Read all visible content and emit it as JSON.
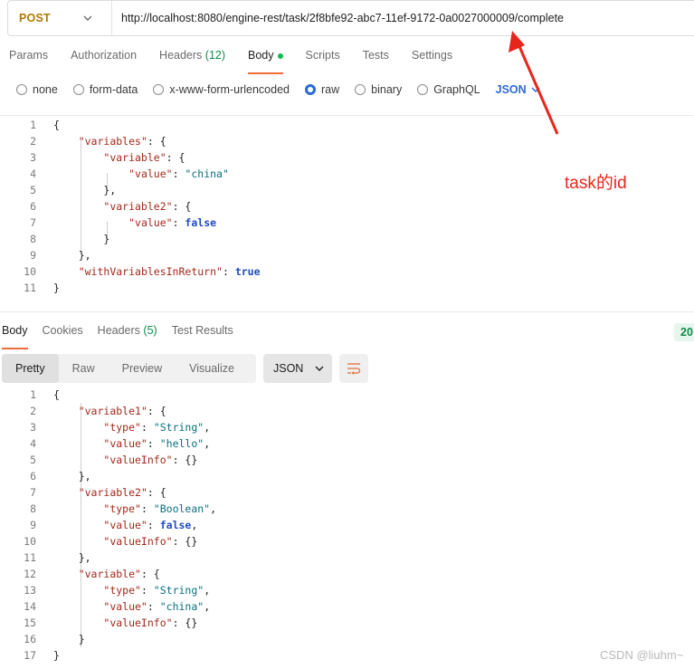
{
  "request": {
    "method": "POST",
    "url": "http://localhost:8080/engine-rest/task/2f8bfe92-abc7-11ef-9172-0a0027000009/complete"
  },
  "request_tabs": [
    {
      "label": "Params"
    },
    {
      "label": "Authorization"
    },
    {
      "label": "Headers",
      "count": "(12)"
    },
    {
      "label": "Body",
      "active": true
    },
    {
      "label": "Scripts"
    },
    {
      "label": "Tests"
    },
    {
      "label": "Settings"
    }
  ],
  "body_types": [
    {
      "label": "none",
      "checked": false
    },
    {
      "label": "form-data",
      "checked": false
    },
    {
      "label": "x-www-form-urlencoded",
      "checked": false
    },
    {
      "label": "raw",
      "checked": true
    },
    {
      "label": "binary",
      "checked": false
    },
    {
      "label": "GraphQL",
      "checked": false
    }
  ],
  "raw_language": "JSON",
  "request_body_lines": [
    {
      "n": "1",
      "tokens": [
        [
          "p",
          "{"
        ]
      ]
    },
    {
      "n": "2",
      "tokens": [
        [
          "p",
          "    "
        ],
        [
          "k",
          "\"variables\""
        ],
        [
          "p",
          ": {"
        ]
      ]
    },
    {
      "n": "3",
      "tokens": [
        [
          "p",
          "        "
        ],
        [
          "k",
          "\"variable\""
        ],
        [
          "p",
          ": {"
        ]
      ]
    },
    {
      "n": "4",
      "tokens": [
        [
          "p",
          "            "
        ],
        [
          "k",
          "\"value\""
        ],
        [
          "p",
          ": "
        ],
        [
          "s",
          "\"china\""
        ]
      ]
    },
    {
      "n": "5",
      "tokens": [
        [
          "p",
          "        },"
        ]
      ]
    },
    {
      "n": "6",
      "tokens": [
        [
          "p",
          "        "
        ],
        [
          "k",
          "\"variable2\""
        ],
        [
          "p",
          ": {"
        ]
      ]
    },
    {
      "n": "7",
      "tokens": [
        [
          "p",
          "            "
        ],
        [
          "k",
          "\"value\""
        ],
        [
          "p",
          ": "
        ],
        [
          "b",
          "false"
        ]
      ]
    },
    {
      "n": "8",
      "tokens": [
        [
          "p",
          "        }"
        ]
      ]
    },
    {
      "n": "9",
      "tokens": [
        [
          "p",
          "    },"
        ]
      ]
    },
    {
      "n": "10",
      "tokens": [
        [
          "p",
          "    "
        ],
        [
          "k",
          "\"withVariablesInReturn\""
        ],
        [
          "p",
          ": "
        ],
        [
          "b",
          "true"
        ]
      ]
    },
    {
      "n": "11",
      "tokens": [
        [
          "p",
          "}"
        ]
      ]
    }
  ],
  "response_tabs": [
    {
      "label": "Body",
      "active": true
    },
    {
      "label": "Cookies"
    },
    {
      "label": "Headers",
      "count": "(5)"
    },
    {
      "label": "Test Results"
    }
  ],
  "response_status": "20",
  "view_modes": [
    {
      "label": "Pretty",
      "active": true
    },
    {
      "label": "Raw"
    },
    {
      "label": "Preview"
    },
    {
      "label": "Visualize"
    }
  ],
  "response_format": "JSON",
  "response_body_lines": [
    {
      "n": "1",
      "tokens": [
        [
          "p",
          "{"
        ]
      ]
    },
    {
      "n": "2",
      "tokens": [
        [
          "p",
          "    "
        ],
        [
          "k",
          "\"variable1\""
        ],
        [
          "p",
          ": {"
        ]
      ]
    },
    {
      "n": "3",
      "tokens": [
        [
          "p",
          "        "
        ],
        [
          "k",
          "\"type\""
        ],
        [
          "p",
          ": "
        ],
        [
          "s",
          "\"String\""
        ],
        [
          "p",
          ","
        ]
      ]
    },
    {
      "n": "4",
      "tokens": [
        [
          "p",
          "        "
        ],
        [
          "k",
          "\"value\""
        ],
        [
          "p",
          ": "
        ],
        [
          "s",
          "\"hello\""
        ],
        [
          "p",
          ","
        ]
      ]
    },
    {
      "n": "5",
      "tokens": [
        [
          "p",
          "        "
        ],
        [
          "k",
          "\"valueInfo\""
        ],
        [
          "p",
          ": {}"
        ]
      ]
    },
    {
      "n": "6",
      "tokens": [
        [
          "p",
          "    },"
        ]
      ]
    },
    {
      "n": "7",
      "tokens": [
        [
          "p",
          "    "
        ],
        [
          "k",
          "\"variable2\""
        ],
        [
          "p",
          ": {"
        ]
      ]
    },
    {
      "n": "8",
      "tokens": [
        [
          "p",
          "        "
        ],
        [
          "k",
          "\"type\""
        ],
        [
          "p",
          ": "
        ],
        [
          "s",
          "\"Boolean\""
        ],
        [
          "p",
          ","
        ]
      ]
    },
    {
      "n": "9",
      "tokens": [
        [
          "p",
          "        "
        ],
        [
          "k",
          "\"value\""
        ],
        [
          "p",
          ": "
        ],
        [
          "b",
          "false"
        ],
        [
          "p",
          ","
        ]
      ]
    },
    {
      "n": "10",
      "tokens": [
        [
          "p",
          "        "
        ],
        [
          "k",
          "\"valueInfo\""
        ],
        [
          "p",
          ": {}"
        ]
      ]
    },
    {
      "n": "11",
      "tokens": [
        [
          "p",
          "    },"
        ]
      ]
    },
    {
      "n": "12",
      "tokens": [
        [
          "p",
          "    "
        ],
        [
          "k",
          "\"variable\""
        ],
        [
          "p",
          ": {"
        ]
      ]
    },
    {
      "n": "13",
      "tokens": [
        [
          "p",
          "        "
        ],
        [
          "k",
          "\"type\""
        ],
        [
          "p",
          ": "
        ],
        [
          "s",
          "\"String\""
        ],
        [
          "p",
          ","
        ]
      ]
    },
    {
      "n": "14",
      "tokens": [
        [
          "p",
          "        "
        ],
        [
          "k",
          "\"value\""
        ],
        [
          "p",
          ": "
        ],
        [
          "s",
          "\"china\""
        ],
        [
          "p",
          ","
        ]
      ]
    },
    {
      "n": "15",
      "tokens": [
        [
          "p",
          "        "
        ],
        [
          "k",
          "\"valueInfo\""
        ],
        [
          "p",
          ": {}"
        ]
      ]
    },
    {
      "n": "16",
      "tokens": [
        [
          "p",
          "    }"
        ]
      ]
    },
    {
      "n": "17",
      "tokens": [
        [
          "p",
          "}"
        ]
      ]
    }
  ],
  "annotation": {
    "text": "task的id",
    "color": "#e8251c"
  },
  "watermark": "CSDN @liuhm~",
  "colors": {
    "method": "#ad7a03",
    "accent_tab": "#f26b3a",
    "radio_checked": "#2c6bd6",
    "status_ok": "#0f8a4a",
    "json_key": "#a3281b",
    "json_string": "#0b6e7e",
    "json_literal": "#1f4cbf"
  },
  "icons": {
    "method_dropdown": "chevron-down-icon",
    "format_dropdown": "chevron-down-icon",
    "wrap": "wrap-lines-icon"
  }
}
